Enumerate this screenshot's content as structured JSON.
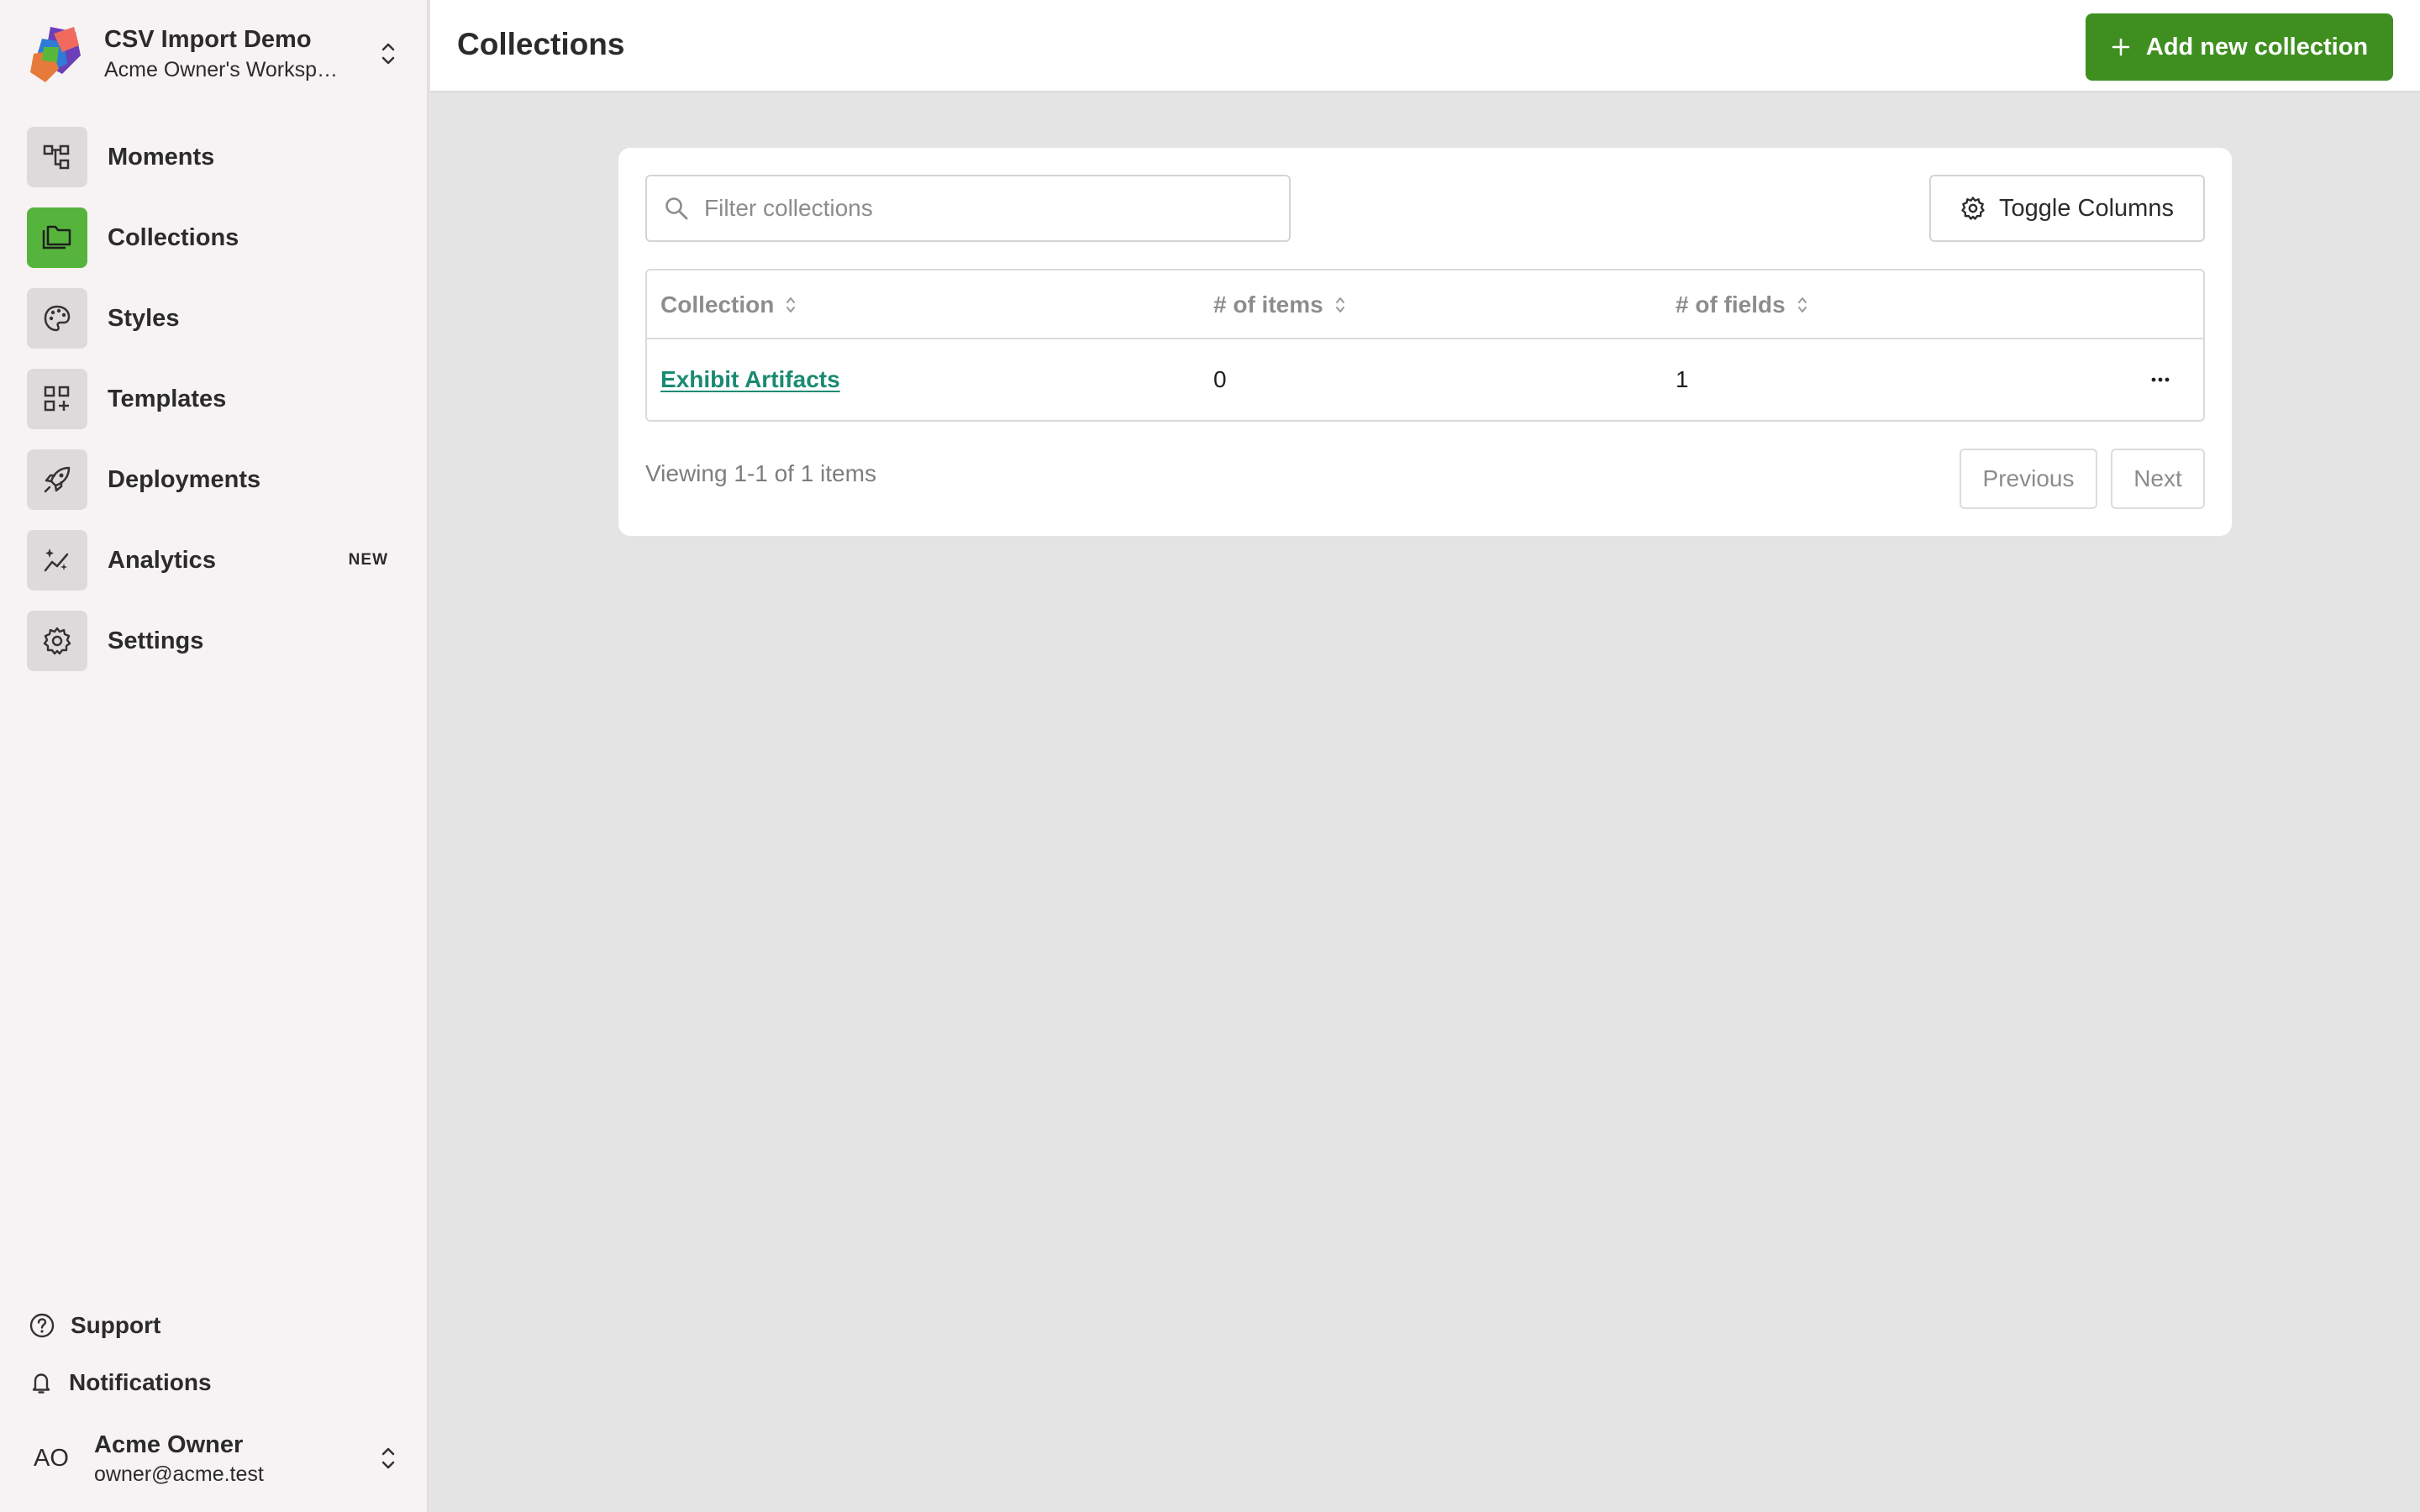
{
  "workspace": {
    "name": "CSV Import Demo",
    "subtitle": "Acme Owner's Workspace"
  },
  "nav": {
    "items": [
      {
        "label": "Moments",
        "icon": "hierarchy-icon"
      },
      {
        "label": "Collections",
        "icon": "folders-icon",
        "active": true
      },
      {
        "label": "Styles",
        "icon": "palette-icon"
      },
      {
        "label": "Templates",
        "icon": "template-grid-icon"
      },
      {
        "label": "Deployments",
        "icon": "rocket-icon"
      },
      {
        "label": "Analytics",
        "icon": "sparkle-chart-icon",
        "badge": "NEW"
      },
      {
        "label": "Settings",
        "icon": "gear-icon"
      }
    ]
  },
  "footer": {
    "support": "Support",
    "notifications": "Notifications",
    "user": {
      "initials": "AO",
      "name": "Acme Owner",
      "email": "owner@acme.test"
    }
  },
  "header": {
    "title": "Collections",
    "add_button": "Add new collection"
  },
  "toolbar": {
    "filter_placeholder": "Filter collections",
    "filter_value": "",
    "toggle_columns": "Toggle Columns"
  },
  "table": {
    "columns": [
      "Collection",
      "# of items",
      "# of fields"
    ],
    "rows": [
      {
        "name": "Exhibit Artifacts",
        "items": "0",
        "fields": "1",
        "menu": "..."
      }
    ]
  },
  "pagination": {
    "summary": "Viewing 1-1 of 1 items",
    "previous": "Previous",
    "next": "Next"
  },
  "colors": {
    "accent": "#3f8f20",
    "active_nav": "#56b43c",
    "link": "#1a8a72",
    "sidebar_bg": "#f7f3f4",
    "content_bg": "#e4e4e4"
  }
}
